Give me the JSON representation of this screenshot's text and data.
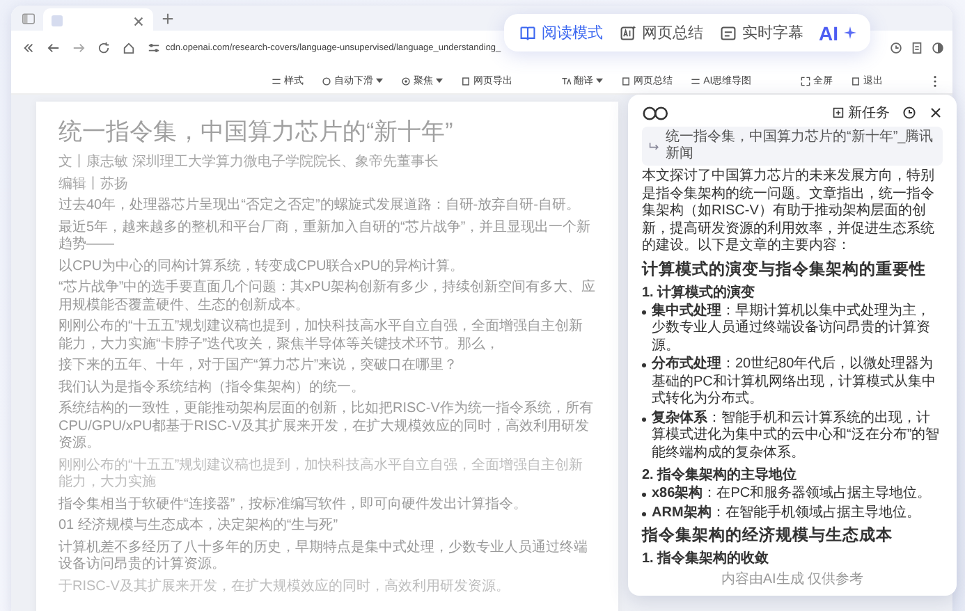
{
  "address": "cdn.openai.com/research-covers/language-unsupervised/language_understanding_",
  "reader_toolbar": {
    "left": [
      {
        "label": "样式",
        "dropdown": false
      },
      {
        "label": "自动下滑",
        "dropdown": true
      },
      {
        "label": "聚焦",
        "dropdown": true
      },
      {
        "label": "网页导出",
        "dropdown": false
      }
    ],
    "middle": [
      {
        "label": "翻译",
        "dropdown": true
      },
      {
        "label": "网页总结",
        "dropdown": false
      },
      {
        "label": "AI思维导图",
        "dropdown": false
      }
    ],
    "right": [
      {
        "label": "全屏",
        "dropdown": false
      },
      {
        "label": "退出",
        "dropdown": false
      }
    ]
  },
  "mode_switcher": [
    {
      "label": "阅读模式",
      "kind": "book",
      "selected": true
    },
    {
      "label": "网页总结",
      "kind": "ai",
      "selected": false
    },
    {
      "label": "实时字幕",
      "kind": "caption",
      "selected": false
    },
    {
      "label": "AI",
      "kind": "brand",
      "selected": false
    }
  ],
  "article": {
    "title": "统一指令集，中国算力芯片的“新十年”",
    "paragraphs": [
      {
        "kind": "meta",
        "text": "文丨康志敏 深圳理工大学算力微电子学院院长、象帝先董事长"
      },
      {
        "kind": "meta",
        "text": "编辑丨苏扬"
      },
      {
        "kind": "body",
        "text": "过去40年，处理器芯片呈现出“否定之否定”的螺旋式发展道路：自研-放弃自研-自研。"
      },
      {
        "kind": "body",
        "text": "最近5年，越来越多的整机和平台厂商，重新加入自研的“芯片战争”，并且显现出一个新趋势——"
      },
      {
        "kind": "body",
        "text": "以CPU为中心的同构计算系统，转变成CPU联合xPU的异构计算。"
      },
      {
        "kind": "body",
        "text": "“芯片战争”中的选手要直面几个问题：其xPU架构创新有多少，持续创新空间有多大、应用规模能否覆盖硬件、生态的创新成本。"
      },
      {
        "kind": "body",
        "text": "刚刚公布的“十五五”规划建议稿也提到，加快科技高水平自立自强，全面增强自主创新能力，大力实施“卡脖子”迭代攻关，聚焦半导体等关键技术环节。那么，"
      },
      {
        "kind": "body",
        "text": "接下来的五年、十年，对于国产“算力芯片”来说，突破口在哪里？"
      },
      {
        "kind": "body",
        "text": "我们认为是指令系统结构（指令集架构）的统一。"
      },
      {
        "kind": "body",
        "text": "系统结构的一致性，更能推动架构层面的创新，比如把RISC-V作为统一指令系统，所有CPU/GPU/xPU都基于RISC-V及其扩展来开发，在扩大规模效应的同时，高效利用研发资源。"
      },
      {
        "kind": "faint",
        "text": "刚刚公布的“十五五”规划建议稿也提到，加快科技高水平自立自强，全面增强自主创新能力，大力实施"
      },
      {
        "kind": "body",
        "text": "指令集相当于软硬件“连接器”，按标准编写软件，即可向硬件发出计算指令。"
      },
      {
        "kind": "body",
        "text": "01 经济规模与生态成本，决定架构的“生与死”"
      },
      {
        "kind": "body",
        "text": "计算机差不多经历了八十多年的历史，早期特点是集中式处理，少数专业人员通过终端设备访问昂贵的计算资源。"
      },
      {
        "kind": "faint",
        "text": "于RISC-V及其扩展来开发，在扩大规模效应的同时，高效利用研发资源。"
      }
    ]
  },
  "assistant": {
    "new_task": "新任务",
    "source": "统一指令集，中国算力芯片的“新十年”_腾讯新闻",
    "intro": "本文探讨了中国算力芯片的未来发展方向，特别是指令集架构的统一问题。文章指出，统一指令集架构（如RISC-V）有助于推动架构层面的创新，提高研发资源的利用效率，并促进生态系统的建设。以下是文章的主要内容：",
    "blocks": [
      {
        "kind": "h2",
        "text": "计算模式的演变与指令集架构的重要性"
      },
      {
        "kind": "h3",
        "text": "1. 计算模式的演变"
      },
      {
        "kind": "bullet",
        "text": "**集中式处理**：早期计算机以集中式处理为主，少数专业人员通过终端设备访问昂贵的计算资源。"
      },
      {
        "kind": "bullet",
        "text": "**分布式处理**：20世纪80年代后，以微处理器为基础的PC和计算机网络出现，计算模式从集中式转化为分布式。"
      },
      {
        "kind": "bullet",
        "text": "**复杂体系**：智能手机和云计算系统的出现，计算模式进化为集中式的云中心和“泛在分布”的智能终端构成的复杂体系。"
      },
      {
        "kind": "h3",
        "text": "2. 指令集架构的主导地位"
      },
      {
        "kind": "bullet",
        "text": "**x86架构**：在PC和服务器领域占据主导地位。"
      },
      {
        "kind": "bullet",
        "text": "**ARM架构**：在智能手机领域占据主导地位。"
      },
      {
        "kind": "h2",
        "text": "指令集架构的经济规模与生态成本"
      },
      {
        "kind": "h3",
        "text": "1. 指令集架构的收敛"
      }
    ],
    "footer": "内容由AI生成 仅供参考"
  }
}
